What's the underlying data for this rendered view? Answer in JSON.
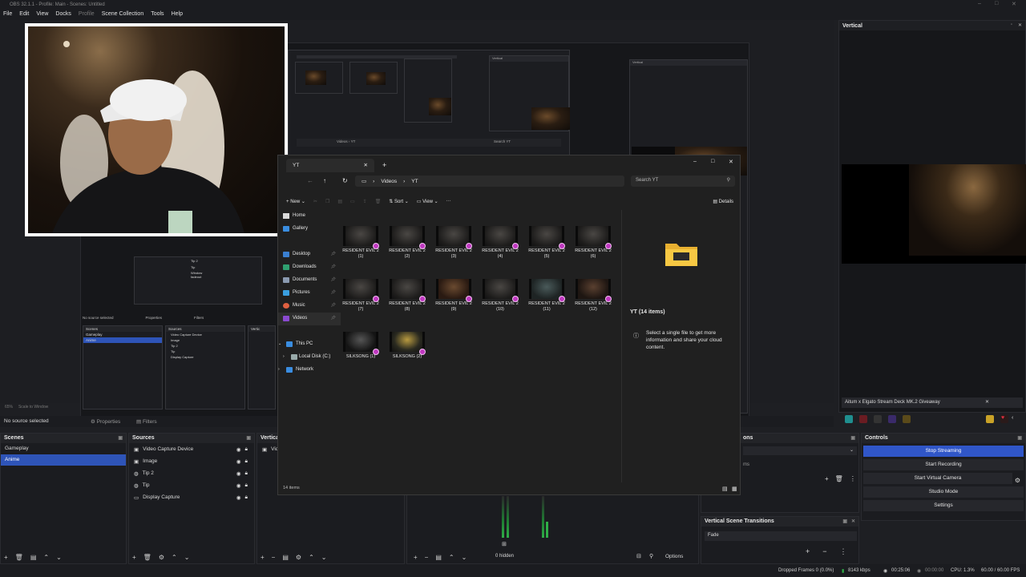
{
  "window": {
    "title": "OBS 32.1.1 - Profile: Main - Scenes: Untitled"
  },
  "menu": [
    {
      "label": "File"
    },
    {
      "label": "Edit"
    },
    {
      "label": "View"
    },
    {
      "label": "Docks"
    },
    {
      "label": "Profile"
    },
    {
      "label": "Scene Collection"
    },
    {
      "label": "Tools"
    },
    {
      "label": "Help"
    }
  ],
  "preview_status": {
    "zoom": "65%",
    "scale": "Scale to Window"
  },
  "source_bar": {
    "no_source": "No source selected",
    "properties": "Properties",
    "filters": "Filters"
  },
  "vertical": {
    "title": "Vertical",
    "giveaway": "Aitum x Elgato Stream Deck MK.2 Giveaway"
  },
  "inner_thumbs": {
    "vertical_label": "Vertical",
    "address": "Videos  ›  YT",
    "search": "Search YT",
    "no_source": "No source selected",
    "properties": "Properties",
    "filters": "Filters",
    "scenes": "Scenes",
    "sources": "Sources",
    "vertical_short": "Vertic",
    "scene_items": [
      "Gameplay",
      "Anime"
    ],
    "source_items": [
      "Video Capture Device",
      "Image",
      "Tip 2",
      "Tip",
      "Display Capture"
    ],
    "menu_items": [
      "Tip 2",
      "Tip",
      "Window fadeout"
    ],
    "zoom": "65%",
    "scale": "Scale to Window"
  },
  "scenes": {
    "title": "Scenes",
    "items": [
      {
        "label": "Gameplay",
        "selected": false
      },
      {
        "label": "Anime",
        "selected": true
      }
    ]
  },
  "sources": {
    "title": "Sources",
    "items": [
      {
        "label": "Video Capture Device",
        "icon": "camera-icon"
      },
      {
        "label": "Image",
        "icon": "image-icon"
      },
      {
        "label": "Tip 2",
        "icon": "globe-icon"
      },
      {
        "label": "Tip",
        "icon": "globe-icon"
      },
      {
        "label": "Display Capture",
        "icon": "monitor-icon"
      }
    ]
  },
  "vertical_sources": {
    "title": "Vertica",
    "first_item": "Vid"
  },
  "transitions": {
    "title_tail": "ons",
    "value_tail": "ms"
  },
  "vertical_transitions": {
    "title": "Vertical Scene Transitions",
    "value": "Fade"
  },
  "controls": {
    "title": "Controls",
    "buttons": [
      "Stop Streaming",
      "Start Recording",
      "Start Virtual Camera",
      "Studio Mode",
      "Settings"
    ]
  },
  "mixer": {
    "hidden": "0 hidden",
    "options": "Options"
  },
  "explorer": {
    "tab_title": "YT",
    "breadcrumb": [
      "Videos",
      "YT"
    ],
    "search_placeholder": "Search YT",
    "toolbar": {
      "new": "New",
      "sort": "Sort",
      "view": "View",
      "details": "Details"
    },
    "nav": [
      {
        "label": "Home"
      },
      {
        "label": "Gallery"
      },
      {
        "label": "Desktop"
      },
      {
        "label": "Downloads"
      },
      {
        "label": "Documents"
      },
      {
        "label": "Pictures"
      },
      {
        "label": "Music"
      },
      {
        "label": "Videos"
      },
      {
        "label": "This PC"
      },
      {
        "label": "Local Disk (C:)"
      },
      {
        "label": "Network"
      }
    ],
    "files": [
      "RESIDENT EVIL 2 (1)",
      "RESIDENT EVIL 2 (2)",
      "RESIDENT EVIL 2 (3)",
      "RESIDENT EVIL 2 (4)",
      "RESIDENT EVIL 2 (5)",
      "RESIDENT EVIL 2 (6)",
      "RESIDENT EVIL 2 (7)",
      "RESIDENT EVIL 2 (8)",
      "RESIDENT EVIL 2 (9)",
      "RESIDENT EVIL 2 (10)",
      "RESIDENT EVIL 2 (11)",
      "RESIDENT EVIL 2 (12)",
      "SILKSONG (1)",
      "SILKSONG (2)"
    ],
    "details_title": "YT (14 items)",
    "details_info": "Select a single file to get more information and share your cloud content.",
    "status": "14 items"
  },
  "statusbar": {
    "dropped": "Dropped Frames 0 (0.0%)",
    "kbps": "8143 kbps",
    "stream_time": "00:25:06",
    "rec_time": "00:00:00",
    "cpu": "CPU: 1.3%",
    "fps": "60.00 / 60.00 FPS"
  },
  "colors": {
    "accent": "#2e54b8",
    "panel": "#1b1c20",
    "explorer_bg": "#202020",
    "badge": "#c038c0"
  }
}
